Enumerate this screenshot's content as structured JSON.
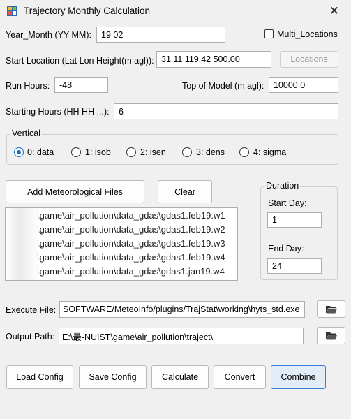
{
  "window": {
    "title": "Trajectory Monthly Calculation",
    "close_glyph": "✕"
  },
  "year_month": {
    "label": "Year_Month (YY MM):",
    "value": "19 02"
  },
  "multi_locations": {
    "label": "Multi_Locations",
    "checked": false
  },
  "start_location": {
    "label": "Start Location (Lat Lon Height(m agl)):",
    "value": "31.11 119.42 500.00",
    "button": "Locations"
  },
  "run_hours": {
    "label": "Run Hours:",
    "value": "-48"
  },
  "top_model": {
    "label": "Top of Model (m agl):",
    "value": "10000.0"
  },
  "starting_hours": {
    "label": "Starting Hours (HH HH ...):",
    "value": "6"
  },
  "vertical": {
    "legend": "Vertical",
    "options": [
      "0: data",
      "1: isob",
      "2: isen",
      "3: dens",
      "4: sigma"
    ],
    "selected": "0: data"
  },
  "buttons": {
    "add_met": "Add Meteorological Files",
    "clear": "Clear"
  },
  "met_files": [
    "\\game\\air_pollution\\data_gdas\\gdas1.feb19.w1",
    "\\game\\air_pollution\\data_gdas\\gdas1.feb19.w2",
    "\\game\\air_pollution\\data_gdas\\gdas1.feb19.w3",
    "\\game\\air_pollution\\data_gdas\\gdas1.feb19.w4",
    "\\game\\air_pollution\\data_gdas\\gdas1.jan19.w4"
  ],
  "duration": {
    "legend": "Duration",
    "start_label": "Start Day:",
    "start_value": "1",
    "end_label": "End Day:",
    "end_value": "24"
  },
  "execute_file": {
    "label": "Execute File:",
    "value": "SOFTWARE/MeteoInfo/plugins/TrajStat\\working\\hyts_std.exe"
  },
  "output_path": {
    "label": "Output Path:",
    "value": "E:\\最-NUIST\\game\\air_pollution\\traject\\"
  },
  "actions": [
    "Load Config",
    "Save Config",
    "Calculate",
    "Convert",
    "Combine"
  ],
  "colors": {
    "separator": "#e04a4a",
    "accent": "#1a6fc7"
  }
}
